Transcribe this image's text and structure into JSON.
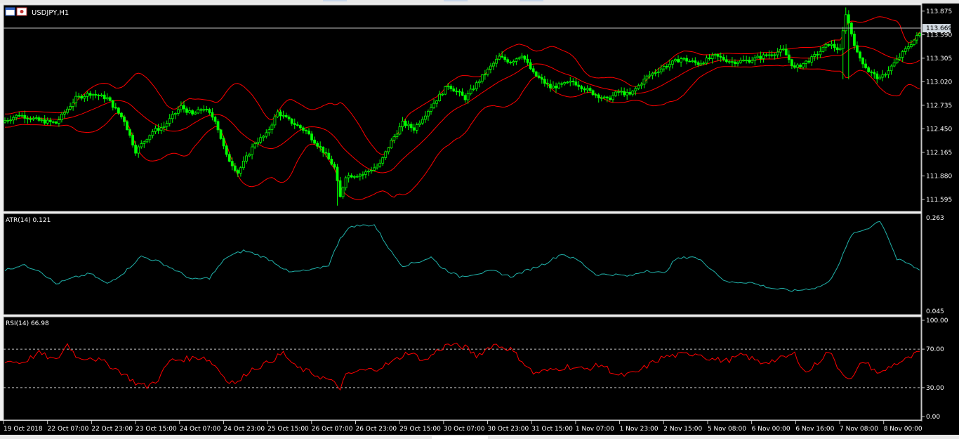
{
  "window": {
    "symbol_label": "USDJPY,H1",
    "icon_names": [
      "chart-window-icon",
      "flag-icon"
    ]
  },
  "colors": {
    "background": "#000000",
    "bull_candle": "#00ff00",
    "bear_candle": "#00ff00",
    "bollinger": "#ff0000",
    "atr_line": "#20b2aa",
    "rsi_line": "#ff0000",
    "grid": "#c0c0c0",
    "price_tag_bg": "#d0d8e0"
  },
  "price_pane": {
    "price_ticks": [
      "113.875",
      "113.590",
      "113.305",
      "113.020",
      "112.735",
      "112.450",
      "112.165",
      "111.880",
      "111.595"
    ],
    "current_price": "113.669"
  },
  "atr_pane": {
    "label": "ATR(14) 0.121",
    "max_label": "0.263",
    "min_label": "0.045"
  },
  "rsi_pane": {
    "label": "RSI(14) 66.98",
    "ticks": [
      "100.00",
      "70.00",
      "30.00",
      "0.00"
    ],
    "levels": [
      70,
      30
    ]
  },
  "time_axis": {
    "labels": [
      "19 Oct 2018",
      "22 Oct 07:00",
      "22 Oct 23:00",
      "23 Oct 15:00",
      "24 Oct 07:00",
      "24 Oct 23:00",
      "25 Oct 15:00",
      "26 Oct 07:00",
      "26 Oct 23:00",
      "29 Oct 15:00",
      "30 Oct 07:00",
      "30 Oct 23:00",
      "31 Oct 15:00",
      "1 Nov 07:00",
      "1 Nov 23:00",
      "2 Nov 15:00",
      "5 Nov 08:00",
      "6 Nov 00:00",
      "6 Nov 16:00",
      "7 Nov 08:00",
      "8 Nov 00:00"
    ]
  },
  "chart_data": {
    "type": "candlestick",
    "symbol": "USDJPY",
    "timeframe": "H1",
    "ylim": [
      111.45,
      113.95
    ],
    "price_path": [
      [
        0,
        112.55
      ],
      [
        5,
        112.62
      ],
      [
        12,
        112.55
      ],
      [
        18,
        112.52
      ],
      [
        25,
        112.82
      ],
      [
        30,
        112.88
      ],
      [
        36,
        112.82
      ],
      [
        42,
        112.55
      ],
      [
        46,
        112.18
      ],
      [
        52,
        112.42
      ],
      [
        56,
        112.48
      ],
      [
        62,
        112.72
      ],
      [
        66,
        112.62
      ],
      [
        70,
        112.7
      ],
      [
        74,
        112.56
      ],
      [
        78,
        112.12
      ],
      [
        82,
        111.92
      ],
      [
        88,
        112.28
      ],
      [
        92,
        112.38
      ],
      [
        96,
        112.65
      ],
      [
        100,
        112.55
      ],
      [
        106,
        112.42
      ],
      [
        112,
        112.18
      ],
      [
        116,
        111.98
      ],
      [
        118,
        111.62
      ],
      [
        120,
        111.88
      ],
      [
        126,
        111.9
      ],
      [
        132,
        112.02
      ],
      [
        136,
        112.3
      ],
      [
        140,
        112.52
      ],
      [
        144,
        112.45
      ],
      [
        150,
        112.72
      ],
      [
        156,
        112.98
      ],
      [
        162,
        112.82
      ],
      [
        168,
        113.08
      ],
      [
        174,
        113.32
      ],
      [
        178,
        113.26
      ],
      [
        182,
        113.35
      ],
      [
        186,
        113.12
      ],
      [
        192,
        112.95
      ],
      [
        196,
        112.98
      ],
      [
        200,
        113.02
      ],
      [
        206,
        112.9
      ],
      [
        212,
        112.8
      ],
      [
        216,
        112.9
      ],
      [
        220,
        112.86
      ],
      [
        226,
        113.08
      ],
      [
        232,
        113.2
      ],
      [
        238,
        113.3
      ],
      [
        244,
        113.24
      ],
      [
        250,
        113.33
      ],
      [
        256,
        113.26
      ],
      [
        262,
        113.28
      ],
      [
        268,
        113.34
      ],
      [
        274,
        113.4
      ],
      [
        278,
        113.18
      ],
      [
        284,
        113.3
      ],
      [
        290,
        113.48
      ],
      [
        294,
        113.4
      ],
      [
        296,
        113.85
      ],
      [
        300,
        113.36
      ],
      [
        304,
        113.15
      ],
      [
        308,
        113.05
      ],
      [
        314,
        113.28
      ],
      [
        318,
        113.45
      ],
      [
        322,
        113.6
      ]
    ],
    "atr_path": [
      [
        0,
        0.14
      ],
      [
        6,
        0.152
      ],
      [
        12,
        0.14
      ],
      [
        18,
        0.108
      ],
      [
        24,
        0.122
      ],
      [
        30,
        0.132
      ],
      [
        36,
        0.108
      ],
      [
        42,
        0.135
      ],
      [
        48,
        0.172
      ],
      [
        54,
        0.16
      ],
      [
        60,
        0.14
      ],
      [
        66,
        0.118
      ],
      [
        72,
        0.122
      ],
      [
        78,
        0.17
      ],
      [
        84,
        0.185
      ],
      [
        88,
        0.178
      ],
      [
        94,
        0.162
      ],
      [
        100,
        0.135
      ],
      [
        108,
        0.14
      ],
      [
        114,
        0.152
      ],
      [
        118,
        0.215
      ],
      [
        122,
        0.242
      ],
      [
        130,
        0.245
      ],
      [
        136,
        0.182
      ],
      [
        140,
        0.15
      ],
      [
        146,
        0.16
      ],
      [
        150,
        0.17
      ],
      [
        154,
        0.145
      ],
      [
        160,
        0.125
      ],
      [
        166,
        0.132
      ],
      [
        172,
        0.138
      ],
      [
        178,
        0.125
      ],
      [
        184,
        0.14
      ],
      [
        190,
        0.155
      ],
      [
        196,
        0.178
      ],
      [
        202,
        0.162
      ],
      [
        208,
        0.13
      ],
      [
        214,
        0.13
      ],
      [
        220,
        0.126
      ],
      [
        226,
        0.14
      ],
      [
        232,
        0.132
      ],
      [
        236,
        0.165
      ],
      [
        242,
        0.172
      ],
      [
        246,
        0.158
      ],
      [
        254,
        0.112
      ],
      [
        262,
        0.112
      ],
      [
        270,
        0.098
      ],
      [
        278,
        0.092
      ],
      [
        286,
        0.1
      ],
      [
        290,
        0.112
      ],
      [
        294,
        0.16
      ],
      [
        298,
        0.222
      ],
      [
        304,
        0.238
      ],
      [
        308,
        0.255
      ],
      [
        310,
        0.23
      ],
      [
        314,
        0.165
      ],
      [
        318,
        0.155
      ],
      [
        322,
        0.14
      ]
    ],
    "rsi_path": [
      [
        0,
        58
      ],
      [
        6,
        56
      ],
      [
        12,
        66
      ],
      [
        18,
        58
      ],
      [
        22,
        75
      ],
      [
        26,
        60
      ],
      [
        30,
        62
      ],
      [
        36,
        55
      ],
      [
        42,
        44
      ],
      [
        46,
        35
      ],
      [
        50,
        31
      ],
      [
        54,
        39
      ],
      [
        58,
        58
      ],
      [
        64,
        60
      ],
      [
        70,
        62
      ],
      [
        74,
        53
      ],
      [
        78,
        38
      ],
      [
        82,
        35
      ],
      [
        86,
        48
      ],
      [
        92,
        55
      ],
      [
        98,
        66
      ],
      [
        102,
        52
      ],
      [
        108,
        45
      ],
      [
        114,
        38
      ],
      [
        118,
        30
      ],
      [
        120,
        42
      ],
      [
        124,
        47
      ],
      [
        130,
        49
      ],
      [
        136,
        56
      ],
      [
        142,
        67
      ],
      [
        148,
        58
      ],
      [
        152,
        68
      ],
      [
        156,
        75
      ],
      [
        162,
        72
      ],
      [
        166,
        63
      ],
      [
        172,
        75
      ],
      [
        178,
        70
      ],
      [
        182,
        58
      ],
      [
        186,
        45
      ],
      [
        192,
        48
      ],
      [
        198,
        52
      ],
      [
        204,
        49
      ],
      [
        210,
        54
      ],
      [
        216,
        42
      ],
      [
        222,
        45
      ],
      [
        228,
        56
      ],
      [
        232,
        62
      ],
      [
        238,
        64
      ],
      [
        244,
        66
      ],
      [
        248,
        60
      ],
      [
        254,
        58
      ],
      [
        260,
        64
      ],
      [
        266,
        56
      ],
      [
        272,
        59
      ],
      [
        278,
        65
      ],
      [
        282,
        45
      ],
      [
        286,
        56
      ],
      [
        290,
        68
      ],
      [
        294,
        48
      ],
      [
        298,
        38
      ],
      [
        302,
        58
      ],
      [
        308,
        44
      ],
      [
        312,
        53
      ],
      [
        318,
        60
      ],
      [
        322,
        67
      ]
    ]
  }
}
